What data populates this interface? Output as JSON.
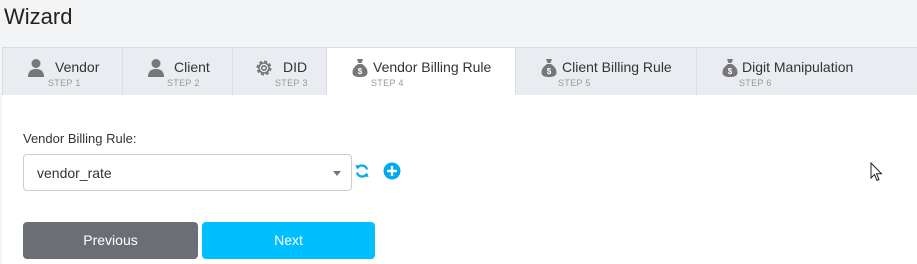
{
  "page": {
    "title": "Wizard"
  },
  "tabs": [
    {
      "label": "Vendor",
      "step": "STEP 1",
      "icon": "user-icon",
      "active": false
    },
    {
      "label": "Client",
      "step": "STEP 2",
      "icon": "user-icon",
      "active": false
    },
    {
      "label": "DID",
      "step": "STEP 3",
      "icon": "gear-icon",
      "active": false
    },
    {
      "label": "Vendor Billing Rule",
      "step": "STEP 4",
      "icon": "money-bag-icon",
      "active": true
    },
    {
      "label": "Client Billing Rule",
      "step": "STEP 5",
      "icon": "money-bag-icon",
      "active": false
    },
    {
      "label": "Digit Manipulation",
      "step": "STEP 6",
      "icon": "money-bag-icon",
      "active": false
    }
  ],
  "form": {
    "field_label": "Vendor Billing Rule:",
    "selected_value": "vendor_rate",
    "refresh_icon": "refresh-icon",
    "add_icon": "plus-circle-icon"
  },
  "buttons": {
    "previous": "Previous",
    "next": "Next"
  },
  "colors": {
    "accent": "#00bfff",
    "previous_button": "#6b6f75",
    "active_tab": "#ffffff",
    "tab_bar": "#e9ecf0"
  }
}
